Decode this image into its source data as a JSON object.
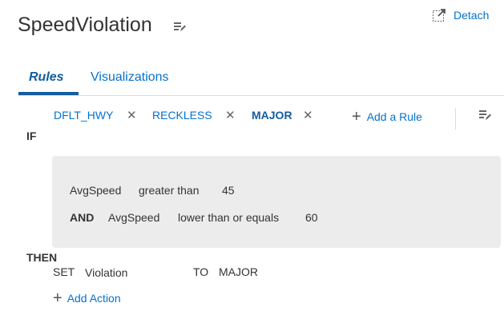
{
  "header": {
    "title": "SpeedViolation",
    "detach_label": "Detach"
  },
  "tabs": [
    {
      "label": "Rules",
      "active": true
    },
    {
      "label": "Visualizations",
      "active": false
    }
  ],
  "rules": {
    "chips": [
      {
        "label": "DFLT_HWY",
        "active": false
      },
      {
        "label": "RECKLESS",
        "active": false
      },
      {
        "label": "MAJOR",
        "active": true
      }
    ],
    "add_rule_label": "Add a Rule"
  },
  "condition": {
    "if_label": "IF",
    "clauses": [
      {
        "connector": "",
        "field": "AvgSpeed",
        "operator": "greater than",
        "value": "45"
      },
      {
        "connector": "AND",
        "field": "AvgSpeed",
        "operator": "lower than or equals",
        "value": "60"
      }
    ]
  },
  "action": {
    "then_label": "THEN",
    "set_label": "SET",
    "target": "Violation",
    "to_label": "TO",
    "value": "MAJOR",
    "add_action_label": "Add Action"
  },
  "colors": {
    "link": "#0572ce",
    "active_tab": "#145c9e",
    "condition_bg": "#ececec"
  }
}
